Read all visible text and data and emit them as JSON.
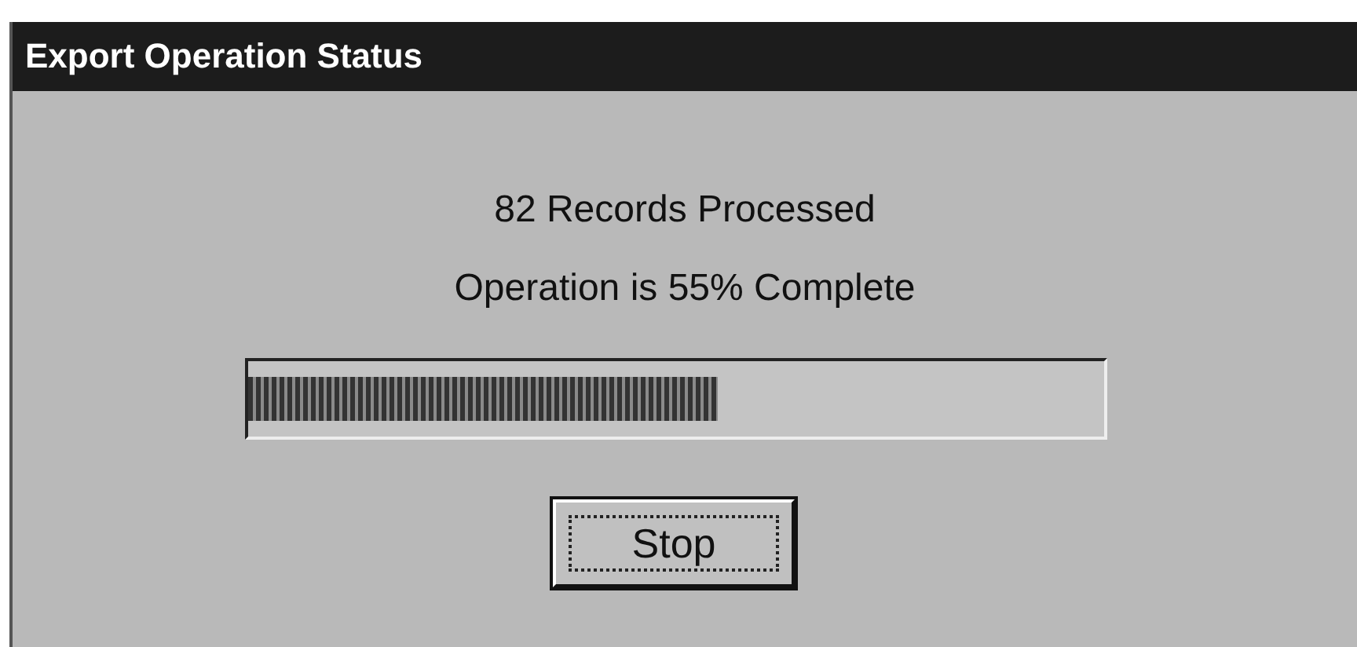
{
  "window": {
    "title": "Export Operation Status"
  },
  "status_lines": [
    "82 Records Processed",
    "Operation is 55% Complete"
  ],
  "progress": {
    "level": 0.55
  },
  "buttons": [
    {
      "label": "Stop",
      "focused": true
    }
  ]
}
